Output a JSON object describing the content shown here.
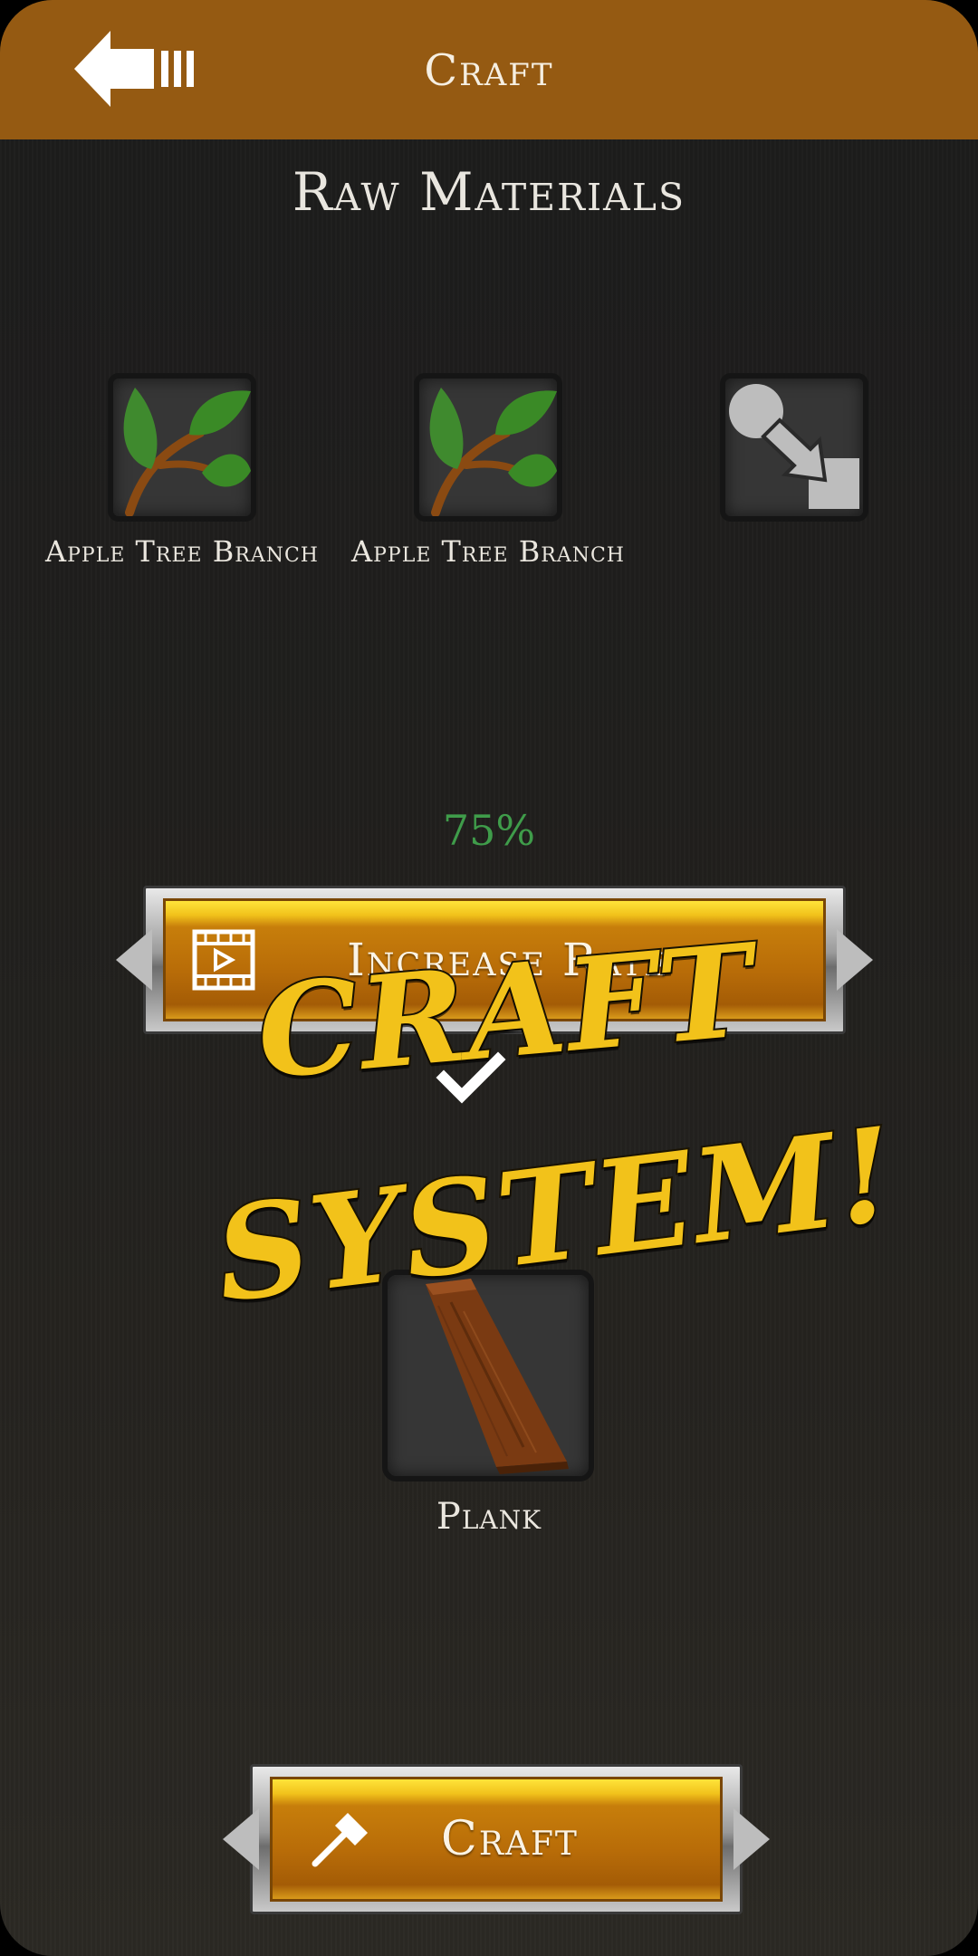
{
  "header": {
    "title": "Craft"
  },
  "section": {
    "title": "Raw Materials"
  },
  "materials": [
    {
      "label": "Apple Tree Branch",
      "icon": "leafy-branch-icon"
    },
    {
      "label": "Apple Tree Branch",
      "icon": "leafy-branch-icon"
    },
    {
      "label": "",
      "icon": "transform-arrow-icon"
    }
  ],
  "success_rate": "75%",
  "increase_rate_button": {
    "label": "Increase Rate",
    "icon": "video-ad-icon"
  },
  "promo": {
    "line1": "CRAFT",
    "line2": "SYSTEM!"
  },
  "result": {
    "label": "Plank",
    "icon": "plank-icon"
  },
  "craft_button": {
    "label": "Craft",
    "icon": "hammer-icon"
  },
  "colors": {
    "header": "#955a12",
    "gold": "#f2c21a",
    "rate": "#3f9c4a",
    "background": "#1f1e1c"
  }
}
